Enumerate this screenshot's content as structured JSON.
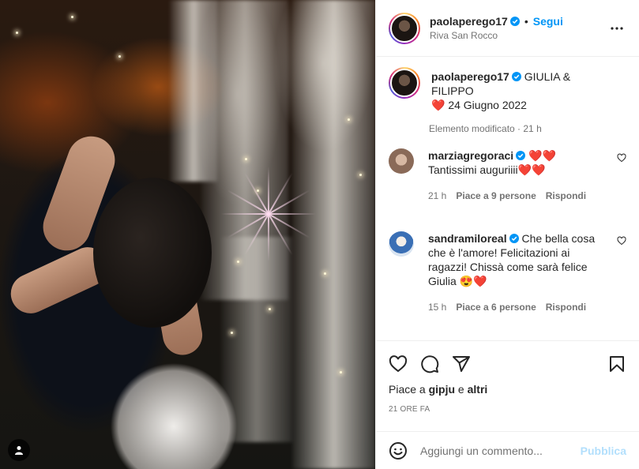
{
  "post": {
    "author": "paolaperego17",
    "location": "Riva San Rocco",
    "follow_label": "Segui",
    "dot": "•"
  },
  "caption": {
    "author": "paolaperego17",
    "text_line1": "GIULIA & FILIPPO",
    "heart": "❤️",
    "text_line2": "24 Giugno 2022",
    "edited": "Elemento modificato · 21 h"
  },
  "comments": [
    {
      "user": "marziagregoraci",
      "text_line1": "❤️❤️",
      "text_line2": "Tantissimi auguriiii❤️❤️",
      "time": "21 h",
      "likes": "Piace a 9 persone",
      "reply": "Rispondi"
    },
    {
      "user": "sandramiloreal",
      "text": "Che bella cosa che è l'amore! Felicitazioni ai ragazzi! Chissà come sarà felice Giulia 😍❤️",
      "time": "15 h",
      "likes": "Piace a 6 persone",
      "reply": "Rispondi"
    }
  ],
  "likes": {
    "prefix": "Piace a ",
    "user": "gipju",
    "connector": " e ",
    "others": "altri"
  },
  "timestamp": "21 ORE FA",
  "add_comment": {
    "placeholder": "Aggiungi un commento...",
    "publish_label": "Pubblica"
  },
  "colors": {
    "accent": "#0095f6",
    "publish_disabled": "#b2dffc",
    "verified": "#0095f6",
    "secondary_text": "#737373"
  },
  "icons": [
    "verified-badge-icon",
    "more-options-icon",
    "heart-icon",
    "comment-icon",
    "share-icon",
    "bookmark-icon",
    "emoji-icon",
    "user-tag-icon"
  ]
}
